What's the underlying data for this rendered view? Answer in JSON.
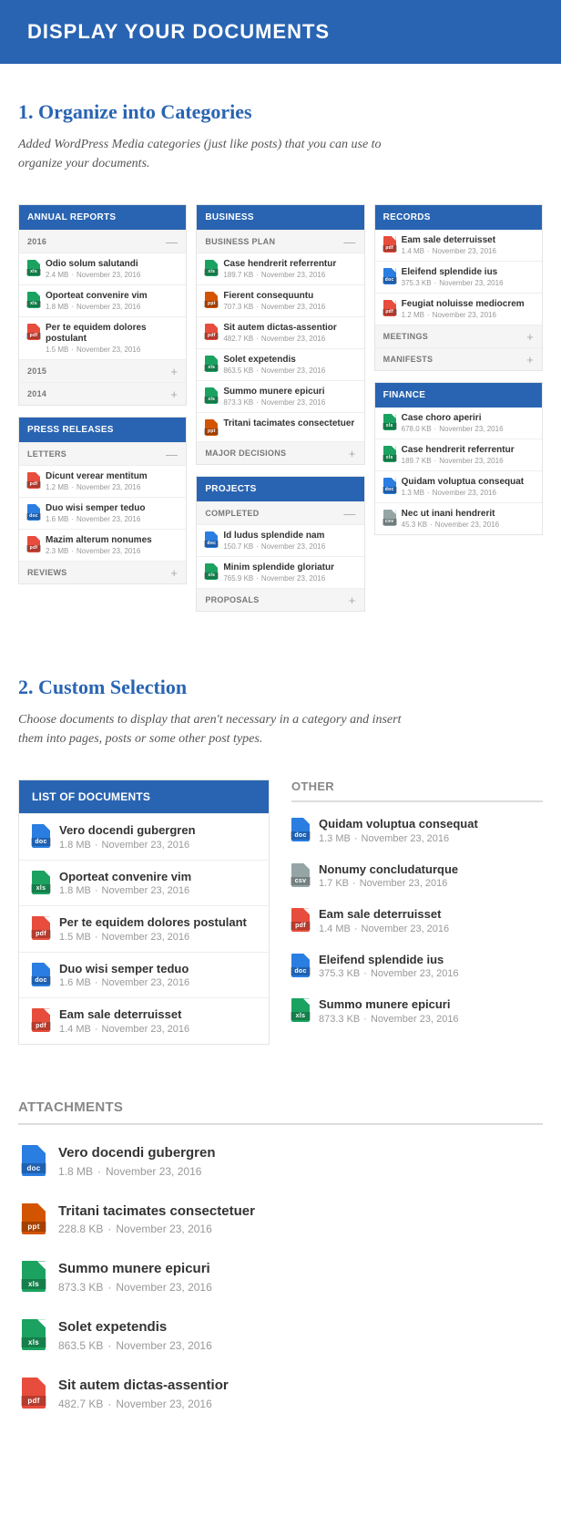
{
  "banner": {
    "title": "DISPLAY YOUR DOCUMENTS"
  },
  "section1": {
    "title": "1. Organize into Categories",
    "desc": "Added WordPress Media categories (just like posts) that you can use to organize your documents."
  },
  "section2": {
    "title": "2. Custom Selection",
    "desc": "Choose documents to display that aren't necessary in a category and insert them into pages, posts or some other post types."
  },
  "icons": {
    "xls": "xls",
    "pdf": "pdf",
    "doc": "doc",
    "ppt": "ppt",
    "csv": "csv"
  },
  "panels": {
    "annual": {
      "title": "ANNUAL REPORTS",
      "groups": [
        {
          "label": "2016",
          "state": "open",
          "items": [
            {
              "type": "xls",
              "title": "Odio solum salutandi",
              "size": "2.4 MB",
              "date": "November 23, 2016"
            },
            {
              "type": "xls",
              "title": "Oporteat convenire vim",
              "size": "1.8 MB",
              "date": "November 23, 2016"
            },
            {
              "type": "pdf",
              "title": "Per te equidem dolores postulant",
              "size": "1.5 MB",
              "date": "November 23, 2016"
            }
          ]
        },
        {
          "label": "2015",
          "state": "closed"
        },
        {
          "label": "2014",
          "state": "closed"
        }
      ]
    },
    "press": {
      "title": "PRESS RELEASES",
      "groups": [
        {
          "label": "LETTERS",
          "state": "open",
          "items": [
            {
              "type": "pdf",
              "title": "Dicunt verear mentitum",
              "size": "1.2 MB",
              "date": "November 23, 2016"
            },
            {
              "type": "doc",
              "title": "Duo wisi semper teduo",
              "size": "1.6 MB",
              "date": "November 23, 2016"
            },
            {
              "type": "pdf",
              "title": "Mazim alterum nonumes",
              "size": "2.3 MB",
              "date": "November 23, 2016"
            }
          ]
        },
        {
          "label": "REVIEWS",
          "state": "closed"
        }
      ]
    },
    "business": {
      "title": "BUSINESS",
      "groups": [
        {
          "label": "BUSINESS PLAN",
          "state": "open",
          "items": [
            {
              "type": "xls",
              "title": "Case hendrerit referrentur",
              "size": "189.7 KB",
              "date": "November 23, 2016"
            },
            {
              "type": "ppt",
              "title": "Fierent consequuntu",
              "size": "707.3 KB",
              "date": "November 23, 2016"
            },
            {
              "type": "pdf",
              "title": "Sit autem dictas-assentior",
              "size": "482.7 KB",
              "date": "November 23, 2016"
            },
            {
              "type": "xls",
              "title": "Solet expetendis",
              "size": "863.5 KB",
              "date": "November 23, 2016"
            },
            {
              "type": "xls",
              "title": "Summo munere epicuri",
              "size": "873.3 KB",
              "date": "November 23, 2016"
            },
            {
              "type": "ppt",
              "title": "Tritani tacimates consectetuer",
              "size": "",
              "date": ""
            }
          ]
        },
        {
          "label": "MAJOR DECISIONS",
          "state": "closed"
        }
      ]
    },
    "projects": {
      "title": "PROJECTS",
      "groups": [
        {
          "label": "COMPLETED",
          "state": "open",
          "items": [
            {
              "type": "doc",
              "title": "Id ludus splendide nam",
              "size": "150.7 KB",
              "date": "November 23, 2016"
            },
            {
              "type": "xls",
              "title": "Minim splendide gloriatur",
              "size": "765.9 KB",
              "date": "November 23, 2016"
            }
          ]
        },
        {
          "label": "PROPOSALS",
          "state": "closed"
        }
      ]
    },
    "records": {
      "title": "RECORDS",
      "items": [
        {
          "type": "pdf",
          "title": "Eam sale deterruisset",
          "size": "1.4 MB",
          "date": "November 23, 2016"
        },
        {
          "type": "doc",
          "title": "Eleifend splendide ius",
          "size": "375.3 KB",
          "date": "November 23, 2016"
        },
        {
          "type": "pdf",
          "title": "Feugiat noluisse mediocrem",
          "size": "1.2 MB",
          "date": "November 23, 2016"
        }
      ],
      "extra": [
        {
          "label": "MEETINGS",
          "state": "closed"
        },
        {
          "label": "MANIFESTS",
          "state": "closed"
        }
      ]
    },
    "finance": {
      "title": "FINANCE",
      "items": [
        {
          "type": "xls",
          "title": "Case choro aperiri",
          "size": "678.0 KB",
          "date": "November 23, 2016"
        },
        {
          "type": "xls",
          "title": "Case hendrerit referrentur",
          "size": "189.7 KB",
          "date": "November 23, 2016"
        },
        {
          "type": "doc",
          "title": "Quidam voluptua consequat",
          "size": "1.3 MB",
          "date": "November 23, 2016"
        },
        {
          "type": "csv",
          "title": "Nec ut inani hendrerit",
          "size": "45.3 KB",
          "date": "November 23, 2016"
        }
      ]
    }
  },
  "list_of_docs": {
    "title": "LIST OF DOCUMENTS",
    "items": [
      {
        "type": "doc",
        "title": "Vero docendi gubergren",
        "size": "1.8 MB",
        "date": "November 23, 2016"
      },
      {
        "type": "xls",
        "title": "Oporteat convenire vim",
        "size": "1.8 MB",
        "date": "November 23, 2016"
      },
      {
        "type": "pdf",
        "title": "Per te equidem dolores postulant",
        "size": "1.5 MB",
        "date": "November 23, 2016"
      },
      {
        "type": "doc",
        "title": "Duo wisi semper teduo",
        "size": "1.6 MB",
        "date": "November 23, 2016"
      },
      {
        "type": "pdf",
        "title": "Eam sale deterruisset",
        "size": "1.4 MB",
        "date": "November 23, 2016"
      }
    ]
  },
  "other": {
    "title": "OTHER",
    "items": [
      {
        "type": "doc",
        "title": "Quidam voluptua consequat",
        "size": "1.3 MB",
        "date": "November 23, 2016"
      },
      {
        "type": "csv",
        "title": "Nonumy concludaturque",
        "size": "1.7 KB",
        "date": "November 23, 2016"
      },
      {
        "type": "pdf",
        "title": "Eam sale deterruisset",
        "size": "1.4 MB",
        "date": "November 23, 2016"
      },
      {
        "type": "doc",
        "title": "Eleifend splendide ius",
        "size": "375.3 KB",
        "date": "November 23, 2016"
      },
      {
        "type": "xls",
        "title": "Summo munere epicuri",
        "size": "873.3 KB",
        "date": "November 23, 2016"
      }
    ]
  },
  "attachments": {
    "title": "ATTACHMENTS",
    "items": [
      {
        "type": "doc",
        "title": "Vero docendi gubergren",
        "size": "1.8 MB",
        "date": "November 23, 2016"
      },
      {
        "type": "ppt",
        "title": "Tritani tacimates consectetuer",
        "size": "228.8 KB",
        "date": "November 23, 2016"
      },
      {
        "type": "xls",
        "title": "Summo munere epicuri",
        "size": "873.3 KB",
        "date": "November 23, 2016"
      },
      {
        "type": "xls",
        "title": "Solet expetendis",
        "size": "863.5 KB",
        "date": "November 23, 2016"
      },
      {
        "type": "pdf",
        "title": "Sit autem dictas-assentior",
        "size": "482.7 KB",
        "date": "November 23, 2016"
      }
    ]
  }
}
